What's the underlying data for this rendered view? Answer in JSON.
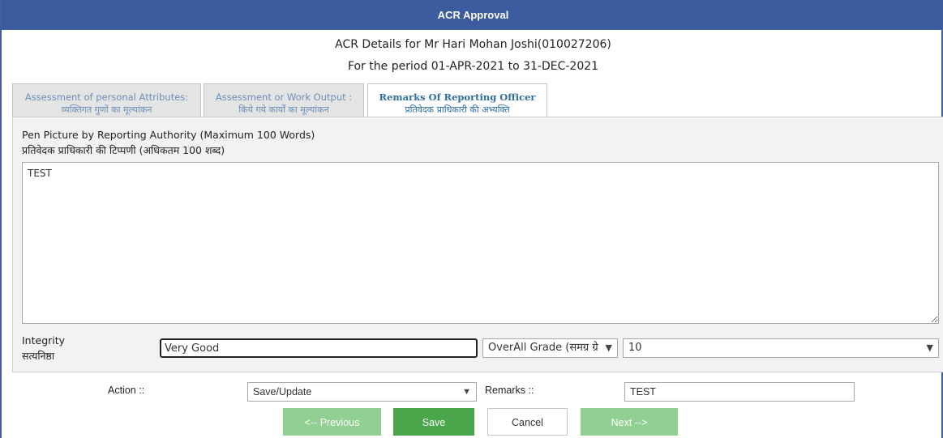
{
  "window": {
    "title": "ACR Approval"
  },
  "header": {
    "line1": "ACR Details for Mr Hari Mohan Joshi(010027206)",
    "line2": "For the period 01-APR-2021 to 31-DEC-2021"
  },
  "tabs": [
    {
      "label": "Assessment of personal Attributes:",
      "sub": "व्यक्तिगत गुणों का मूल्यांकन",
      "active": false
    },
    {
      "label": "Assessment or Work Output :",
      "sub": "किये गये कार्यों का मूल्यांकन",
      "active": false
    },
    {
      "label": "Remarks Of Reporting Officer",
      "sub": "प्रतिवेदक प्राधिकारी की अभ्यक्ति",
      "active": true
    }
  ],
  "pen_picture": {
    "label_en": "Pen Picture by Reporting Authority (Maximum 100 Words)",
    "label_hi": "प्रतिवेदक प्राधिकारी की टिप्पणी (अधिकतम 100 शब्द)",
    "value": "TEST"
  },
  "integrity": {
    "label_en": "Integrity",
    "label_hi": "सत्यनिष्ठा",
    "value": "Very Good"
  },
  "grade": {
    "select_label": "OverAll Grade (समग्र ग्रे",
    "value": "10"
  },
  "action": {
    "label": "Action ::",
    "value": "Save/Update"
  },
  "remarks": {
    "label": "Remarks ::",
    "value": "TEST"
  },
  "buttons": {
    "previous": "<-- Previous",
    "save": "Save",
    "cancel": "Cancel",
    "next": "Next -->"
  },
  "icons": {
    "dropdown": "chevron-down-icon",
    "resize": "resize-grip-icon"
  },
  "colors": {
    "titlebar": "#3d5c9f",
    "button_green": "#49a64a",
    "button_disabled": "#92cf92",
    "tab_text": "#2e6da4"
  }
}
